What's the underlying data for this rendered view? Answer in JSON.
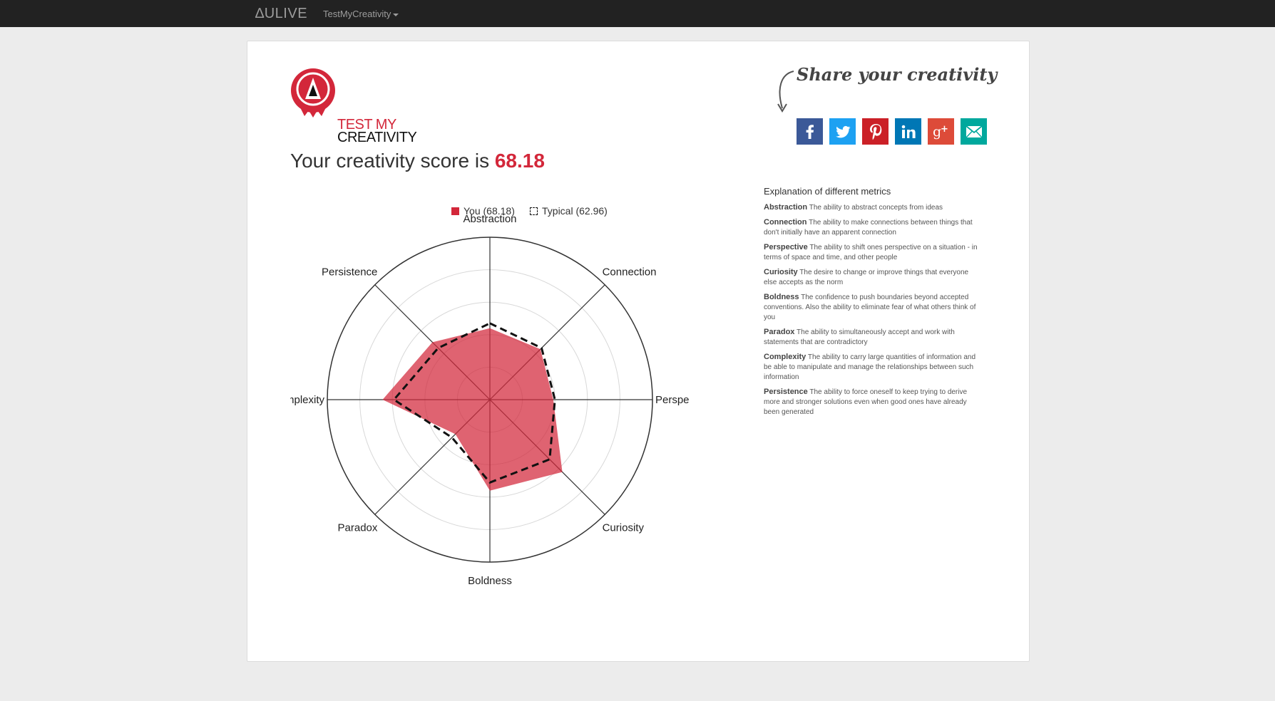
{
  "navbar": {
    "brand": "∆ULIVE",
    "menu_label": "TestMyCreativity"
  },
  "logo": {
    "line1": "TEST MY",
    "line2": "CREATIVITY"
  },
  "share": {
    "title": "Share your creativity",
    "buttons": [
      {
        "network": "facebook",
        "icon": "facebook-icon",
        "color": "#3b5998"
      },
      {
        "network": "twitter",
        "icon": "twitter-icon",
        "color": "#1da1f2"
      },
      {
        "network": "pinterest",
        "icon": "pinterest-icon",
        "color": "#cb2027"
      },
      {
        "network": "linkedin",
        "icon": "linkedin-icon",
        "color": "#0077b5"
      },
      {
        "network": "google-plus",
        "icon": "google-plus-icon",
        "color": "#dd4b39"
      },
      {
        "network": "email",
        "icon": "email-icon",
        "color": "#00a89d"
      }
    ]
  },
  "score": {
    "prefix": "Your creativity score is ",
    "value": "68.18"
  },
  "chart_data": {
    "type": "radar",
    "axes": [
      "Abstraction",
      "Connection",
      "Perspective",
      "Curiosity",
      "Boldness",
      "Paradox",
      "Complexity",
      "Persistence"
    ],
    "rmax": 100,
    "rings": 5,
    "series": [
      {
        "name": "You (68.18)",
        "values": [
          44,
          44,
          39,
          63,
          56,
          30,
          66,
          50
        ],
        "color": "#d3273a",
        "style": "filled"
      },
      {
        "name": "Typical (62.96)",
        "values": [
          47,
          45,
          40,
          52,
          51,
          33,
          59,
          45
        ],
        "color": "#111111",
        "style": "dashed"
      }
    ],
    "legend_position": "top"
  },
  "metrics": {
    "title": "Explanation of different metrics",
    "items": [
      {
        "name": "Abstraction",
        "desc": "The ability to abstract concepts from ideas"
      },
      {
        "name": "Connection",
        "desc": "The ability to make connections between things that don't initially have an apparent connection"
      },
      {
        "name": "Perspective",
        "desc": "The ability to shift ones perspective on a situation - in terms of space and time, and other people"
      },
      {
        "name": "Curiosity",
        "desc": "The desire to change or improve things that everyone else accepts as the norm"
      },
      {
        "name": "Boldness",
        "desc": "The confidence to push boundaries beyond accepted conventions. Also the ability to eliminate fear of what others think of you"
      },
      {
        "name": "Paradox",
        "desc": "The ability to simultaneously accept and work with statements that are contradictory"
      },
      {
        "name": "Complexity",
        "desc": "The ability to carry large quantities of information and be able to manipulate and manage the relationships between such information"
      },
      {
        "name": "Persistence",
        "desc": "The ability to force oneself to keep trying to derive more and stronger solutions even when good ones have already been generated"
      }
    ]
  }
}
